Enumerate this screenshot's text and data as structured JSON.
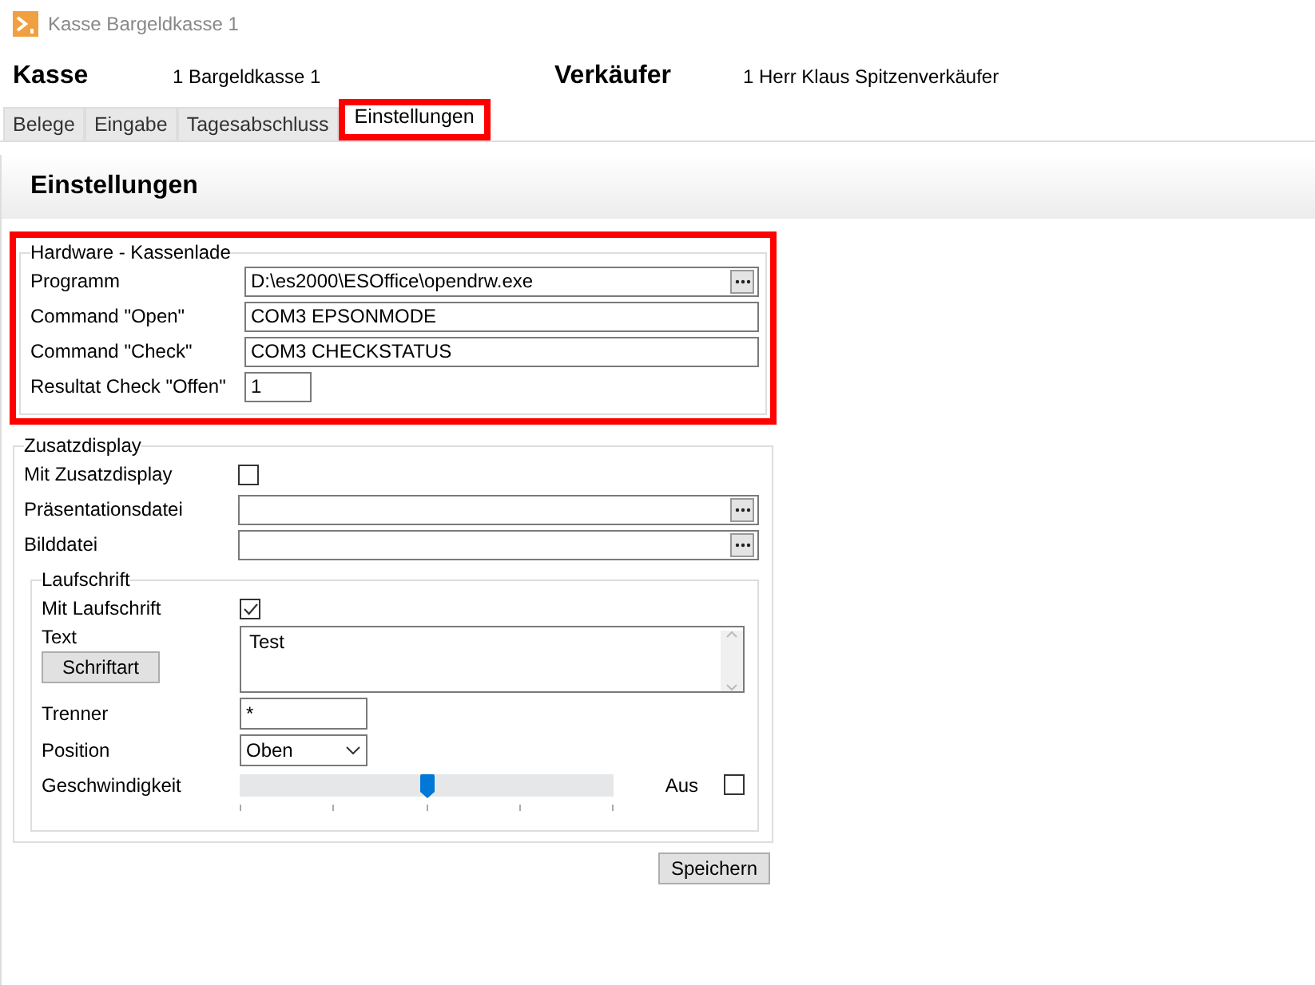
{
  "window": {
    "title": "Kasse Bargeldkasse 1"
  },
  "header": {
    "kasse_label": "Kasse",
    "kasse_value": "1  Bargeldkasse 1",
    "verkaeufer_label": "Verkäufer",
    "verkaeufer_value": "1  Herr Klaus Spitzenverkäufer"
  },
  "tabs": [
    {
      "label": "Belege",
      "selected": false,
      "highlighted": false
    },
    {
      "label": "Eingabe",
      "selected": false,
      "highlighted": false
    },
    {
      "label": "Tagesabschluss",
      "selected": false,
      "highlighted": false
    },
    {
      "label": "Einstellungen",
      "selected": true,
      "highlighted": true
    }
  ],
  "page_title": "Einstellungen",
  "hardware": {
    "title": "Hardware - Kassenlade",
    "highlighted": true,
    "rows": [
      {
        "label": "Programm",
        "value": "D:\\es2000\\ESOffice\\opendrw.exe",
        "browse": true,
        "short": false
      },
      {
        "label": "Command \"Open\"",
        "value": "COM3 EPSONMODE",
        "browse": false,
        "short": false
      },
      {
        "label": "Command \"Check\"",
        "value": "COM3 CHECKSTATUS",
        "browse": false,
        "short": false
      },
      {
        "label": "Resultat Check \"Offen\"",
        "value": "1",
        "browse": false,
        "short": true
      }
    ]
  },
  "zusatzdisplay": {
    "title": "Zusatzdisplay",
    "mit_label": "Mit Zusatzdisplay",
    "mit_checked": false,
    "files": [
      {
        "label": "Präsentationsdatei",
        "browse": true
      },
      {
        "label": "Bilddatei",
        "browse": true
      }
    ],
    "laufschrift": {
      "title": "Laufschrift",
      "mit_label": "Mit Laufschrift",
      "mit_checked": true,
      "text_label": "Text",
      "text_value": "Test",
      "font_button": "Schriftart",
      "trenner_label": "Trenner",
      "trenner_value": "*",
      "position_label": "Position",
      "position_value": "Oben",
      "speed_label": "Geschwindigkeit",
      "speed": {
        "level": 0.5
      },
      "aus_label": "Aus",
      "aus_checked": false
    }
  },
  "save_button": "Speichern"
}
